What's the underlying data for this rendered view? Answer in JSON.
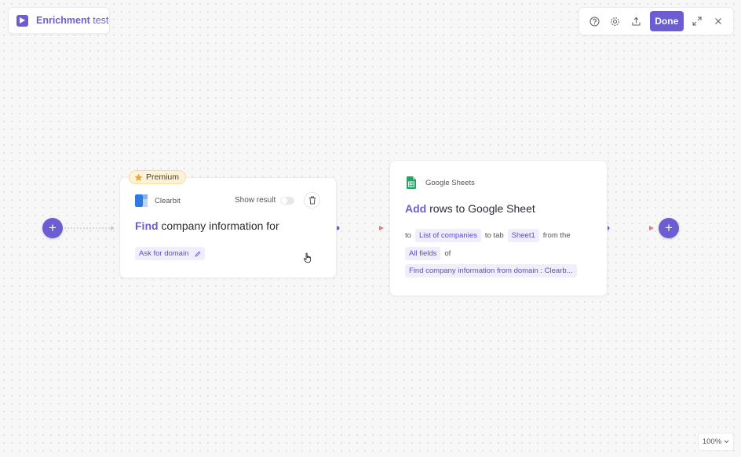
{
  "header": {
    "title_bold": "Enrichment",
    "title_rest": " test"
  },
  "toolbar": {
    "done_label": "Done",
    "icons": [
      "help-icon",
      "gear-icon",
      "share-icon",
      "expand-icon",
      "close-icon"
    ]
  },
  "node1": {
    "badge": "Premium",
    "app_name": "Clearbit",
    "show_result_label": "Show result",
    "verb": "Find",
    "heading_rest": " company information for",
    "input_chip": "Ask for domain"
  },
  "node2": {
    "app_name": "Google Sheets",
    "verb": "Add",
    "heading_rest": " rows to Google Sheet",
    "to_label": "to",
    "sheet_chip": "List of companies",
    "to_tab_label": "to tab",
    "tab_chip": "Sheet1",
    "from_the_label": "from the",
    "fields_chip": "All fields",
    "of_label": "of",
    "source_chip": "Find company information from domain : Clearb..."
  },
  "zoom": {
    "level": "100%"
  },
  "colors": {
    "accent": "#6c5dd3",
    "connector_end": "#e57b7b",
    "premium_bg": "#fff2d6"
  }
}
